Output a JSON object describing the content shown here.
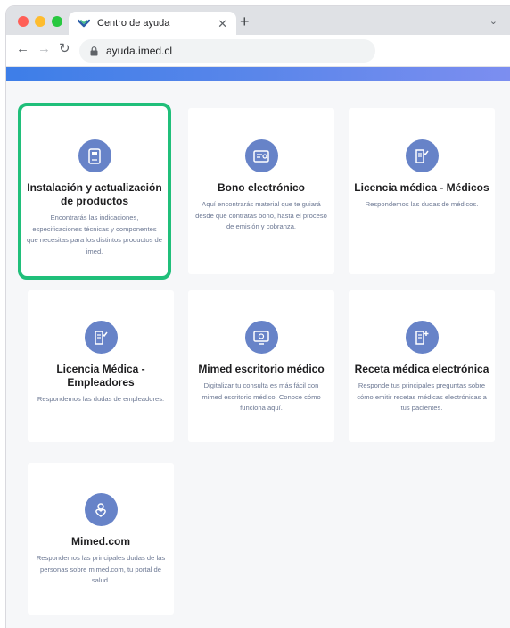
{
  "browser": {
    "tab_title": "Centro de ayuda",
    "url": "ayuda.imed.cl"
  },
  "colors": {
    "accent": "#6783c8",
    "highlight": "#20bf7a",
    "banner": "#4a7ee8"
  },
  "cards": [
    {
      "title": "Instalación y actualización de productos",
      "description": "Encontrarás las indicaciones, especificaciones técnicas y componentes que necesitas para los distintos productos de imed.",
      "icon": "device-icon"
    },
    {
      "title": "Bono electrónico",
      "description": "Aquí encontrarás material que te guiará desde que contratas bono, hasta el proceso de emisión y cobranza.",
      "icon": "certificate-icon"
    },
    {
      "title": "Licencia médica - Médicos",
      "description": "Respondemos las dudas de médicos.",
      "icon": "document-check-icon"
    },
    {
      "title": "Licencia Médica - Empleadores",
      "description": "Respondemos las dudas de empleadores.",
      "icon": "document-check-icon"
    },
    {
      "title": "Mimed escritorio médico",
      "description": "Digitalizar tu consulta es más fácil con mimed escritorio médico. Conoce cómo funciona aquí.",
      "icon": "monitor-icon"
    },
    {
      "title": "Receta médica electrónica",
      "description": "Responde tus principales preguntas sobre cómo emitir recetas médicas electrónicas a tus pacientes.",
      "icon": "document-plus-icon"
    },
    {
      "title": "Mimed.com",
      "description": "Respondemos las principales dudas de las personas sobre mimed.com, tu portal de salud.",
      "icon": "user-heart-icon"
    }
  ]
}
